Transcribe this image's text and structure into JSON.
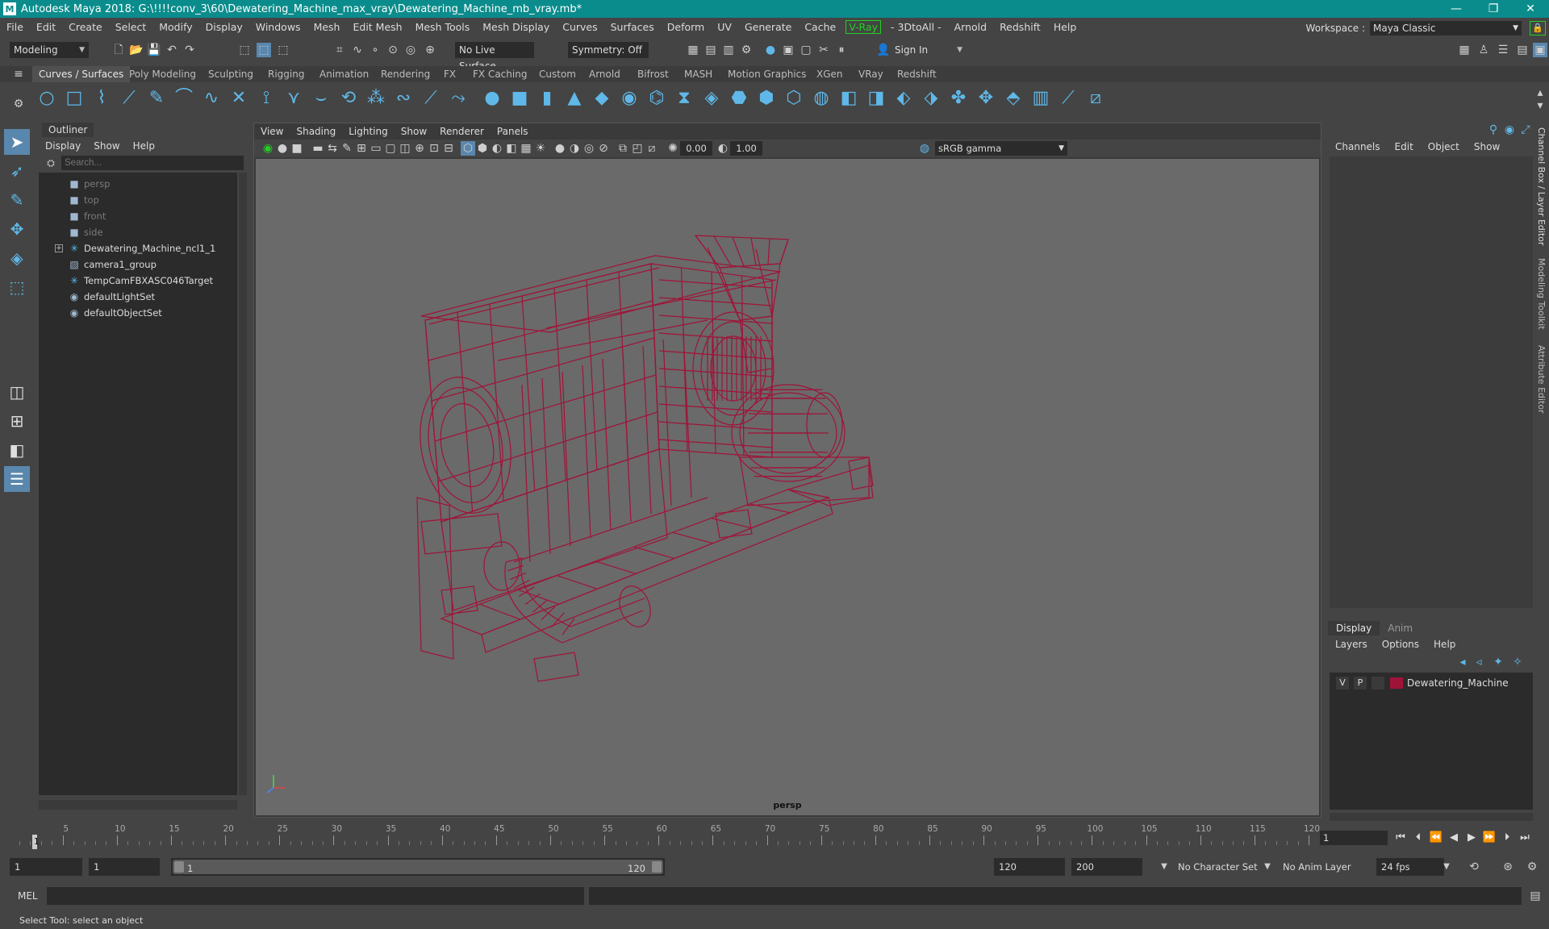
{
  "window": {
    "title": "Autodesk Maya 2018: G:\\!!!!conv_3\\60\\Dewatering_Machine_max_vray\\Dewatering_Machine_mb_vray.mb*",
    "app_icon": "M"
  },
  "menubar": {
    "items": [
      "File",
      "Edit",
      "Create",
      "Select",
      "Modify",
      "Display",
      "Windows",
      "Mesh",
      "Edit Mesh",
      "Mesh Tools",
      "Mesh Display",
      "Curves",
      "Surfaces",
      "Deform",
      "UV",
      "Generate",
      "Cache",
      "V-Ray",
      "- 3DtoAll -",
      "Arnold",
      "Redshift",
      "Help"
    ]
  },
  "workspace": {
    "label": "Workspace :",
    "value": "Maya Classic"
  },
  "statusline": {
    "mode": "Modeling",
    "live_surface": "No Live Surface",
    "symmetry": "Symmetry: Off",
    "sign_in": "Sign In"
  },
  "shelf": {
    "tabs": [
      "Curves / Surfaces",
      "Poly Modeling",
      "Sculpting",
      "Rigging",
      "Animation",
      "Rendering",
      "FX",
      "FX Caching",
      "Custom",
      "Arnold",
      "Bifrost",
      "MASH",
      "Motion Graphics",
      "XGen",
      "VRay",
      "Redshift"
    ],
    "active_tab": "Curves / Surfaces"
  },
  "outliner": {
    "title": "Outliner",
    "menu": [
      "Display",
      "Show",
      "Help"
    ],
    "search_placeholder": "Search...",
    "items": [
      {
        "label": "persp",
        "icon": "camera-icon",
        "dim": true
      },
      {
        "label": "top",
        "icon": "camera-icon",
        "dim": true
      },
      {
        "label": "front",
        "icon": "camera-icon",
        "dim": true
      },
      {
        "label": "side",
        "icon": "camera-icon",
        "dim": true
      },
      {
        "label": "Dewatering_Machine_ncl1_1",
        "icon": "transform-icon",
        "dim": false,
        "expandable": true
      },
      {
        "label": "camera1_group",
        "icon": "group-icon",
        "dim": false
      },
      {
        "label": "TempCamFBXASC046Target",
        "icon": "transform-icon",
        "dim": false
      },
      {
        "label": "defaultLightSet",
        "icon": "set-icon",
        "dim": false
      },
      {
        "label": "defaultObjectSet",
        "icon": "set-icon",
        "dim": false
      }
    ]
  },
  "viewport": {
    "menu": [
      "View",
      "Shading",
      "Lighting",
      "Show",
      "Renderer",
      "Panels"
    ],
    "exposure": "0.00",
    "gamma_value": "1.00",
    "color_space": "sRGB gamma",
    "camera": "persp",
    "wire_color": "#a01338",
    "background_color": "#6a6a6a"
  },
  "channelbox": {
    "menu": [
      "Channels",
      "Edit",
      "Object",
      "Show"
    ]
  },
  "layers": {
    "tabs": [
      "Display",
      "Anim"
    ],
    "active_tab": "Display",
    "menu": [
      "Layers",
      "Options",
      "Help"
    ],
    "rows": [
      {
        "v": "V",
        "p": "P",
        "name": "Dewatering_Machine",
        "color": "#a01338"
      }
    ]
  },
  "side_tabs": [
    "Channel Box / Layer Editor",
    "Modeling Toolkit",
    "Attribute Editor"
  ],
  "timeline": {
    "ticks": [
      "5",
      "10",
      "15",
      "20",
      "25",
      "30",
      "35",
      "40",
      "45",
      "50",
      "55",
      "60",
      "65",
      "70",
      "75",
      "80",
      "85",
      "90",
      "95",
      "100",
      "105",
      "110",
      "115",
      "120"
    ],
    "current_frame": "1",
    "current_frame_field": "1"
  },
  "range": {
    "start_field": "1",
    "playback_start": "1",
    "slider_start": "1",
    "slider_end": "120",
    "playback_end": "120",
    "end_field": "200",
    "character_set": "No Character Set",
    "anim_layer": "No Anim Layer",
    "fps": "24 fps"
  },
  "cmdline": {
    "label": "MEL"
  },
  "helpline": {
    "text": "Select Tool: select an object"
  }
}
